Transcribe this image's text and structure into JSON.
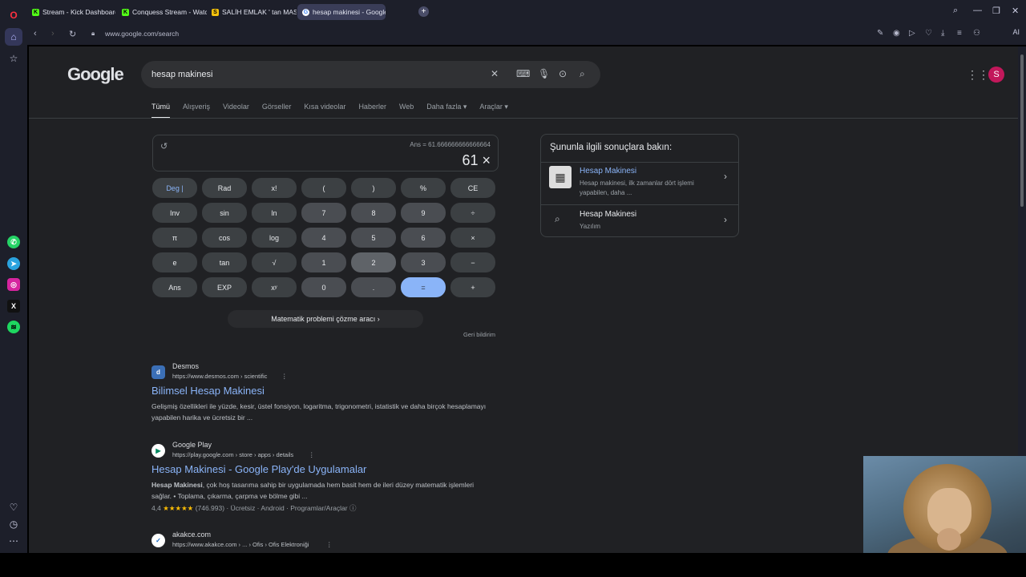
{
  "browser": {
    "tabs": [
      {
        "label": "Stream - Kick Dashboard",
        "favicon": "K"
      },
      {
        "label": "Conquess Stream - Watch",
        "favicon": "K"
      },
      {
        "label": "SALİH EMLAK ' tan MASRA",
        "favicon": "S"
      },
      {
        "label": "hesap makinesi - Google",
        "favicon": "G"
      }
    ],
    "url": "www.google.com/search",
    "ai_label": "AI"
  },
  "search": {
    "logo": "Google",
    "query": "hesap makinesi",
    "avatar_letter": "S"
  },
  "nav_tabs": [
    "Tümü",
    "Alışveriş",
    "Videolar",
    "Görseller",
    "Kısa videolar",
    "Haberler",
    "Web",
    "Daha fazla ▾",
    "Araçlar ▾"
  ],
  "calculator": {
    "ans_line": "Ans = 61.666666666666664",
    "display": "61 ×",
    "keys": [
      [
        "Deg | ",
        "Rad",
        "x!",
        "(",
        ")",
        "%",
        "CE"
      ],
      [
        "Inv",
        "sin",
        "ln",
        "7",
        "8",
        "9",
        "÷"
      ],
      [
        "π",
        "cos",
        "log",
        "4",
        "5",
        "6",
        "×"
      ],
      [
        "e",
        "tan",
        "√",
        "1",
        "2",
        "3",
        "−"
      ],
      [
        "Ans",
        "EXP",
        "xʸ",
        "0",
        ".",
        "=",
        "+"
      ]
    ],
    "solver_label": "Matematik problemi çözme aracı  ›",
    "feedback": "Geri bildirim"
  },
  "results": [
    {
      "site": "Desmos",
      "url": "https://www.desmos.com › scientific",
      "title": "Bilimsel Hesap Makinesi",
      "snippet": "Gelişmiş özellikleri ile yüzde, kesir, üstel fonsiyon, logaritma, trigonometri, istatistik ve daha birçok hesaplamayı yapabilen harika ve ücretsiz bir ...",
      "fav": "d"
    },
    {
      "site": "Google Play",
      "url": "https://play.google.com › store › apps › details",
      "title": "Hesap Makinesi - Google Play'de Uygulamalar",
      "snippet_bold": "Hesap Makinesi",
      "snippet": ", çok hoş tasarıma sahip bir uygulamada hem basit hem de ileri düzey matematik işlemleri sağlar. • Toplama, çıkarma, çarpma ve bölme gibi ...",
      "rating": "4,4",
      "stars": "★★★★★",
      "meta": "(746.993) · Ücretsiz · Android · Programlar/Araçlar",
      "fav": "▶"
    },
    {
      "site": "akakce.com",
      "url": "https://www.akakce.com › ... › Ofis › Ofis Elektroniği",
      "fav": "✓"
    }
  ],
  "side_panel": {
    "heading": "Şununla ilgili sonuçlara bakın:",
    "items": [
      {
        "title": "Hesap Makinesi",
        "desc": "Hesap makinesi, ilk zamanlar dört işlemi yapabilen, daha ..."
      },
      {
        "title": "Hesap Makinesi",
        "desc": "Yazılım"
      }
    ]
  },
  "colors": {
    "link": "#8ab4f8",
    "page_bg": "#202124",
    "equals_key": "#8ab4f8"
  }
}
